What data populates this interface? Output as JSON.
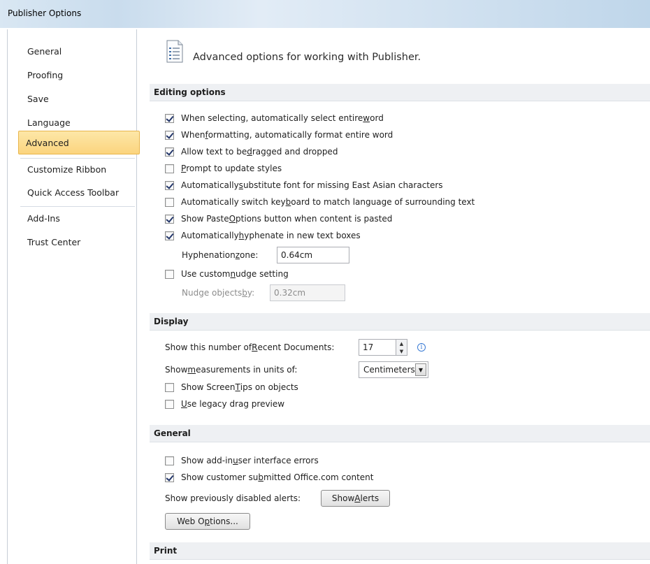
{
  "window": {
    "title": "Publisher Options"
  },
  "nav": {
    "items": [
      {
        "label": "General"
      },
      {
        "label": "Proofing"
      },
      {
        "label": "Save"
      },
      {
        "label": "Language"
      },
      {
        "label": "Advanced",
        "selected": true
      },
      {
        "label": "Customize Ribbon"
      },
      {
        "label": "Quick Access Toolbar"
      },
      {
        "label": "Add-Ins"
      },
      {
        "label": "Trust Center"
      }
    ]
  },
  "header": {
    "text": "Advanced options for working with Publisher.",
    "icon": "settings-page-icon"
  },
  "editing": {
    "title": "Editing options",
    "opt1": {
      "pre": "When selecting, automatically select entire ",
      "u": "w",
      "post": "ord",
      "checked": true
    },
    "opt2": {
      "pre": "When ",
      "u": "f",
      "post": "ormatting, automatically format entire word",
      "checked": true
    },
    "opt3": {
      "pre": "Allow text to be ",
      "u": "d",
      "post": "ragged and dropped",
      "checked": true
    },
    "opt4": {
      "pre": "",
      "u": "P",
      "post": "rompt to update styles",
      "checked": false
    },
    "opt5": {
      "pre": "Automatically ",
      "u": "s",
      "post": "ubstitute font for missing East Asian characters",
      "checked": true
    },
    "opt6": {
      "pre": "Automatically switch key",
      "u": "b",
      "post": "oard to match language of surrounding text",
      "checked": false
    },
    "opt7": {
      "pre": "Show Paste ",
      "u": "O",
      "post": "ptions button when content is pasted",
      "checked": true
    },
    "opt8": {
      "pre": "Automatically ",
      "u": "h",
      "post": "yphenate in new text boxes",
      "checked": true
    },
    "hyphenation": {
      "pre": "Hyphenation ",
      "u": "z",
      "post": "one:",
      "value": "0.64cm"
    },
    "nudge_custom": {
      "pre": "Use custom ",
      "u": "n",
      "post": "udge setting",
      "checked": false
    },
    "nudge_by": {
      "pre": "Nudge objects ",
      "u": "b",
      "post": "y:",
      "value": "0.32cm"
    }
  },
  "display": {
    "title": "Display",
    "recent_docs": {
      "pre": "Show this number of ",
      "u": "R",
      "post": "ecent Documents:",
      "value": "17"
    },
    "units": {
      "pre": "Show ",
      "u": "m",
      "post": "easurements in units of:",
      "value": "Centimeters"
    },
    "screentips": {
      "pre": "Show Screen",
      "u": "T",
      "post": "ips on objects",
      "checked": false
    },
    "legacy_drag": {
      "pre": "",
      "u": "U",
      "post": "se legacy drag preview",
      "checked": false
    }
  },
  "general": {
    "title": "General",
    "addin_errors": {
      "pre": "Show add-in ",
      "u": "u",
      "post": "ser interface errors",
      "checked": false
    },
    "customer_content": {
      "pre": "Show customer su",
      "u": "b",
      "post": "mitted Office.com content",
      "checked": true
    },
    "disabled_alerts_label": "Show previously disabled alerts:",
    "show_alerts_btn": {
      "pre": "Show ",
      "u": "A",
      "post": "lerts"
    },
    "web_options_btn": {
      "pre": "Web O",
      "u": "p",
      "post": "tions..."
    }
  },
  "print": {
    "title": "Print"
  }
}
